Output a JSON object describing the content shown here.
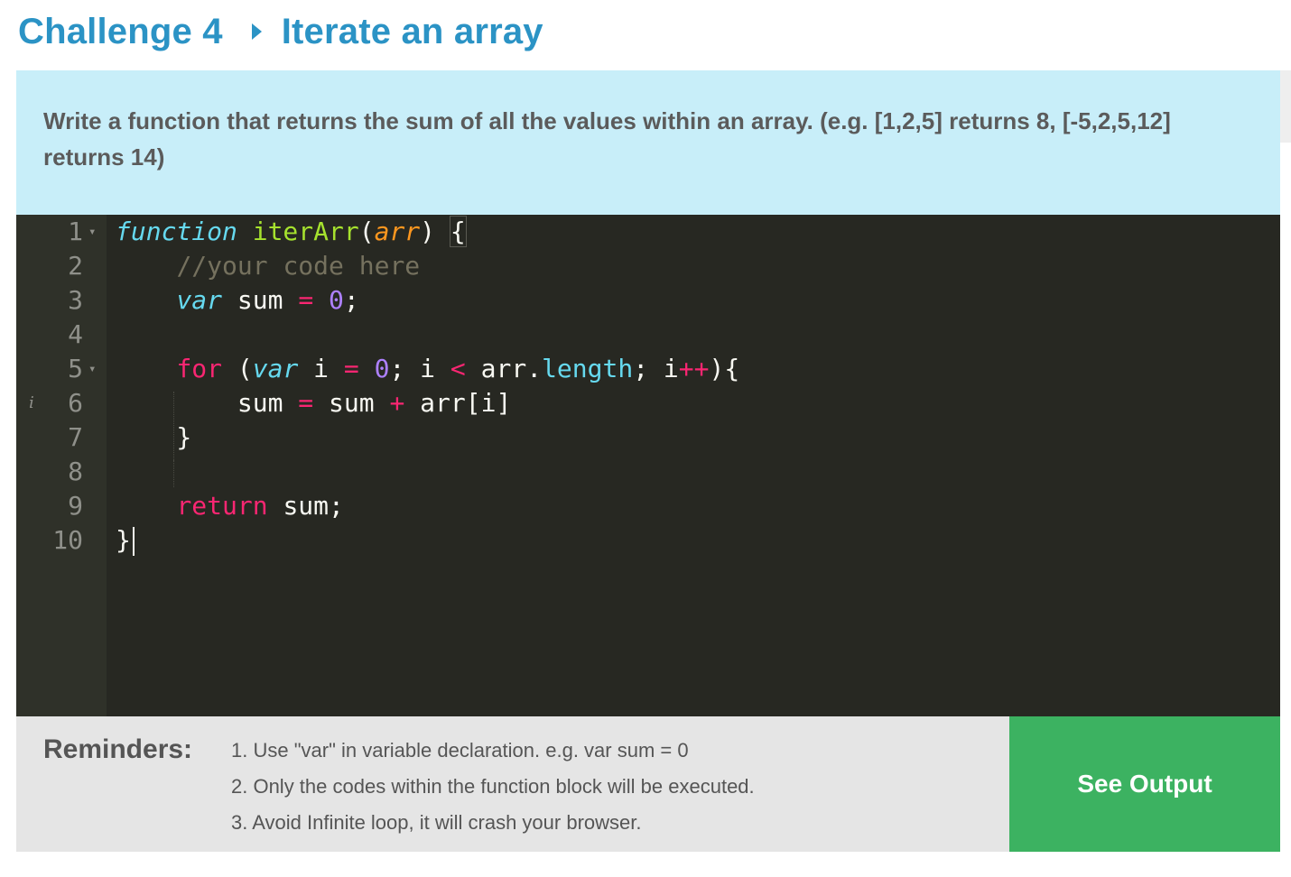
{
  "header": {
    "challenge": "Challenge 4",
    "title": "Iterate an array"
  },
  "description": "Write a function that returns the sum of all the values within an array. (e.g. [1,2,5] returns 8, [-5,2,5,12] returns 14)",
  "editor": {
    "line_numbers": [
      "1",
      "2",
      "3",
      "4",
      "5",
      "6",
      "7",
      "8",
      "9",
      "10"
    ],
    "code": [
      "function iterArr(arr) {",
      "    //your code here",
      "    var sum = 0;",
      "",
      "    for (var i = 0; i < arr.length; i++){",
      "        sum = sum + arr[i]",
      "    }",
      "",
      "    return sum;",
      "}"
    ]
  },
  "reminders": {
    "title": "Reminders:",
    "items": [
      "1. Use \"var\" in variable declaration. e.g. var sum = 0",
      "2. Only the codes within the function block will be executed.",
      "3. Avoid Infinite loop, it will crash your browser."
    ]
  },
  "output_button": "See Output",
  "colors": {
    "accent": "#2b93c5",
    "description_bg": "#c8eef9",
    "editor_bg": "#272822",
    "button_green": "#3cb261"
  }
}
